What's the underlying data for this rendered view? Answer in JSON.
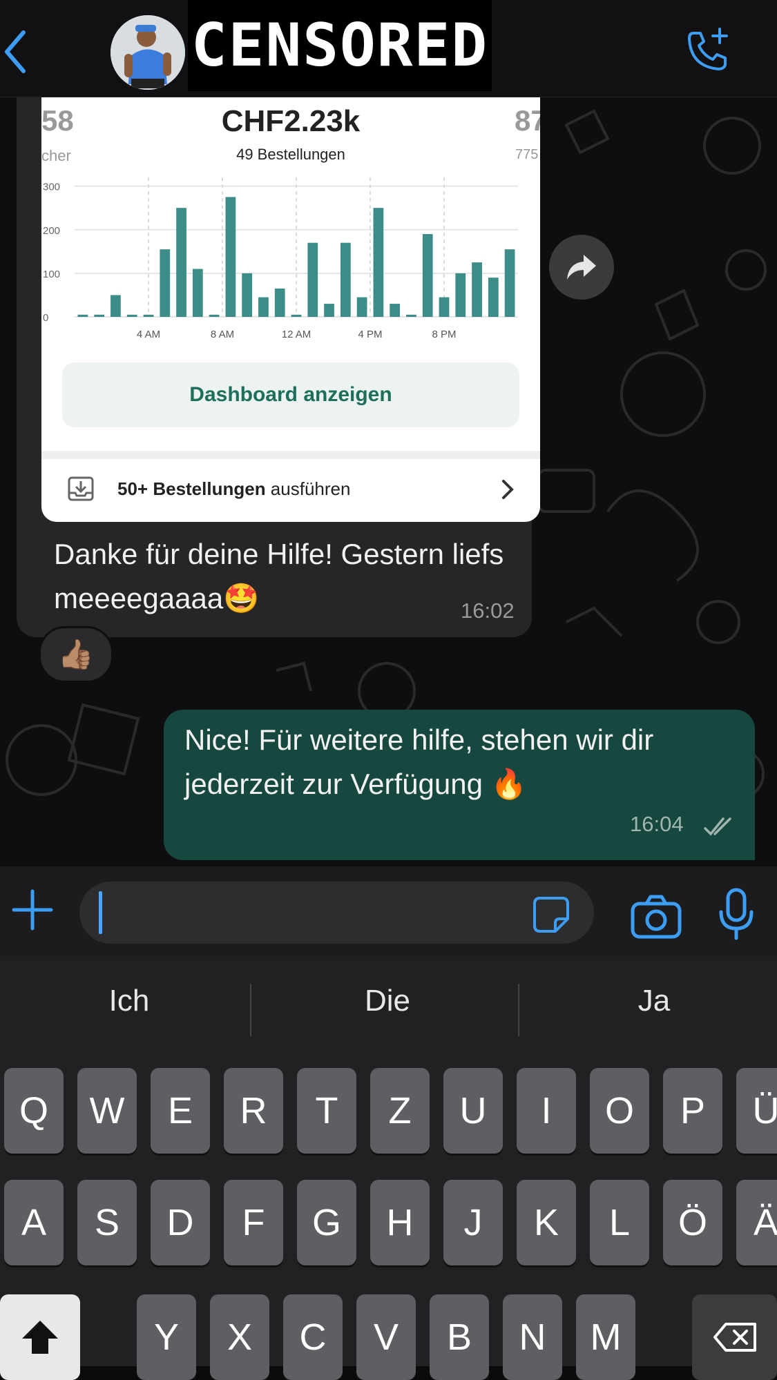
{
  "header": {
    "censor_label": "CENSORED"
  },
  "stats_card": {
    "left_partial_value": "58",
    "left_partial_label": "cher",
    "total": "CHF2.23k",
    "orders": "49 Bestellungen",
    "right_partial_value": "87",
    "right_partial_label": "775",
    "dashboard_button": "Dashboard anzeigen",
    "fulfill_bold": "50+ Bestellungen",
    "fulfill_rest": " ausführen"
  },
  "chart_data": {
    "type": "bar",
    "title": "",
    "xlabel": "",
    "ylabel": "",
    "ylim": [
      0,
      320
    ],
    "yticks": [
      0,
      100,
      200,
      300
    ],
    "x_tick_labels": [
      "4 AM",
      "8 AM",
      "12 AM",
      "4 PM",
      "8 PM"
    ],
    "x_tick_hours": [
      4,
      8,
      12,
      16,
      20
    ],
    "hours": [
      0,
      1,
      2,
      3,
      4,
      5,
      6,
      7,
      8,
      9,
      10,
      11,
      12,
      13,
      14,
      15,
      16,
      17,
      18,
      19,
      20,
      21,
      22,
      23
    ],
    "values": [
      5,
      5,
      50,
      5,
      5,
      155,
      250,
      110,
      5,
      275,
      100,
      45,
      65,
      5,
      170,
      30,
      170,
      45,
      250,
      30,
      5,
      190,
      45,
      100,
      125,
      90,
      155
    ],
    "grid": true,
    "color": "#3c8c88"
  },
  "messages": {
    "incoming_text": "Danke für deine Hilfe! Gestern liefs meeeegaaaa🤩",
    "incoming_time": "16:02",
    "reaction": "👍🏽",
    "outgoing_text": "Nice! Für weitere hilfe, stehen wir dir jederzeit zur Verfügung 🔥",
    "outgoing_time": "16:04"
  },
  "keyboard": {
    "suggestions": [
      "Ich",
      "Die",
      "Ja"
    ],
    "row1": [
      "Q",
      "W",
      "E",
      "R",
      "T",
      "Z",
      "U",
      "I",
      "O",
      "P",
      "Ü"
    ],
    "row2": [
      "A",
      "S",
      "D",
      "F",
      "G",
      "H",
      "J",
      "K",
      "L",
      "Ö",
      "Ä"
    ],
    "row3": [
      "Y",
      "X",
      "C",
      "V",
      "B",
      "N",
      "M"
    ]
  },
  "colors": {
    "accent_blue": "#3d9df2",
    "outgoing_bubble": "#17483f",
    "incoming_bubble": "#262628",
    "chart_bar": "#3c8c88",
    "dashboard_text": "#1e6e5c"
  }
}
